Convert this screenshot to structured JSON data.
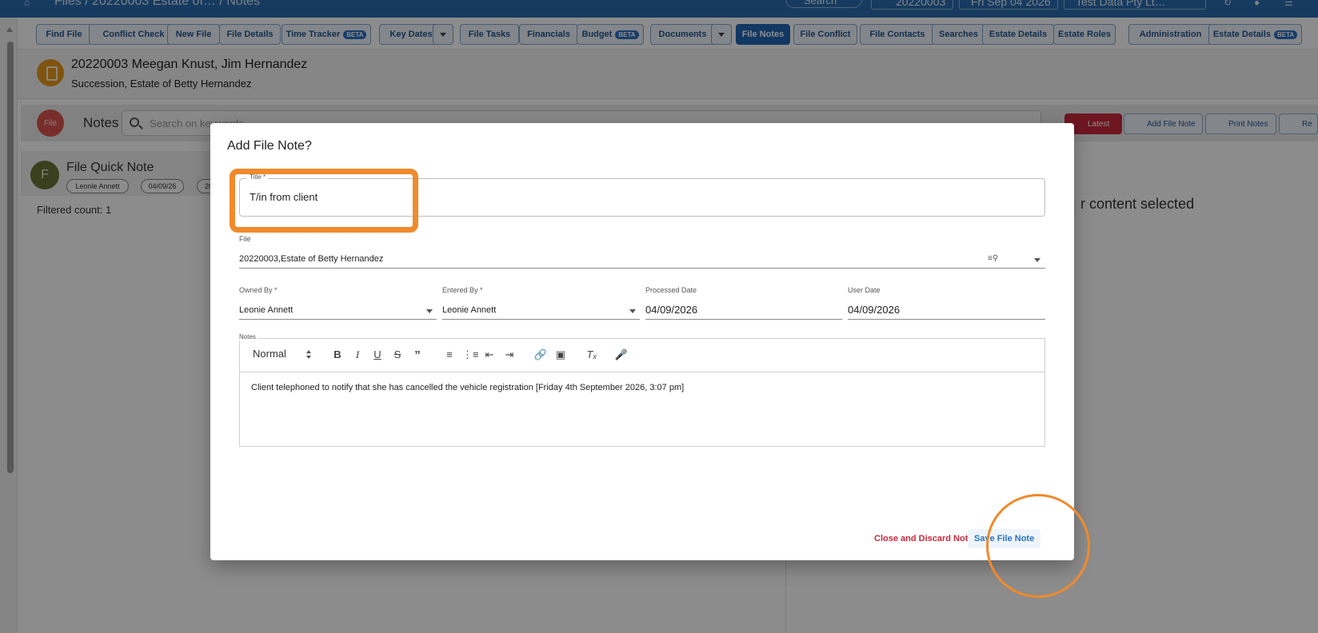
{
  "appbar": {
    "breadcrumb": "Files / 20220003 Estate of… / Notes",
    "search_label": "Search",
    "file_button": "20220003",
    "date_button": "Fri Sep 04 2026",
    "org_button": "Test Data Pty Lt…"
  },
  "toolbar": {
    "items": [
      {
        "label": "Find File"
      },
      {
        "label": "Conflict Check"
      },
      {
        "label": "New File"
      },
      {
        "label": "File Details"
      },
      {
        "label": "Time Tracker",
        "badge": "BETA"
      },
      {
        "label": "Key Dates"
      },
      {
        "label": "File Tasks"
      },
      {
        "label": "Financials"
      },
      {
        "label": "Budget",
        "badge": "BETA"
      },
      {
        "label": "Documents"
      },
      {
        "label": "File Notes",
        "active": true
      },
      {
        "label": "File Conflict"
      },
      {
        "label": "File Contacts"
      },
      {
        "label": "Searches"
      },
      {
        "label": "Estate Details"
      },
      {
        "label": "Estate Roles"
      },
      {
        "label": "Administration"
      },
      {
        "label": "Estate Details",
        "badge": "BETA"
      }
    ]
  },
  "file_header": {
    "title": "20220003 Meegan Knust, Jim Hernandez",
    "subtitle": "Succession, Estate of Betty Hernandez"
  },
  "notes_bar": {
    "badge": "File",
    "label": "Notes",
    "search_placeholder": "Search on keywords",
    "filter_count": "1",
    "latest_button": "Latest",
    "add_button": "Add File Note",
    "print_button": "Print Notes",
    "remove_button": "Re"
  },
  "note_list": {
    "card": {
      "avatar": "F",
      "title": "File Quick Note",
      "owner": "Leonie Annett",
      "date": "04/09/26",
      "extra": "20"
    },
    "filtered_count": "Filtered count: 1"
  },
  "right_pane": {
    "message": "r content selected"
  },
  "dialog": {
    "title": "Add File Note?",
    "title_field": {
      "label": "Title *",
      "value": "T/in from client"
    },
    "file_field": {
      "label": "File",
      "value": "20220003,Estate of Betty Hernandez"
    },
    "owned_by": {
      "label": "Owned By *",
      "value": "Leonie Annett"
    },
    "entered_by": {
      "label": "Entered By *",
      "value": "Leonie Annett"
    },
    "processed_date": {
      "label": "Processed Date",
      "value": "04/09/2026"
    },
    "user_date": {
      "label": "User Date",
      "value": "04/09/2026"
    },
    "notes": {
      "label": "Notes",
      "format": "Normal",
      "body": "Client telephoned to notify that she has cancelled the vehicle registration [Friday 4th September 2026, 3:07 pm]"
    },
    "discard_label": "Close and Discard Note",
    "save_label": "Save File Note"
  },
  "colors": {
    "appbar": "#2b6cb0",
    "highlight": "#f08a2c",
    "danger": "#c8283c",
    "primary": "#2a73c0"
  }
}
